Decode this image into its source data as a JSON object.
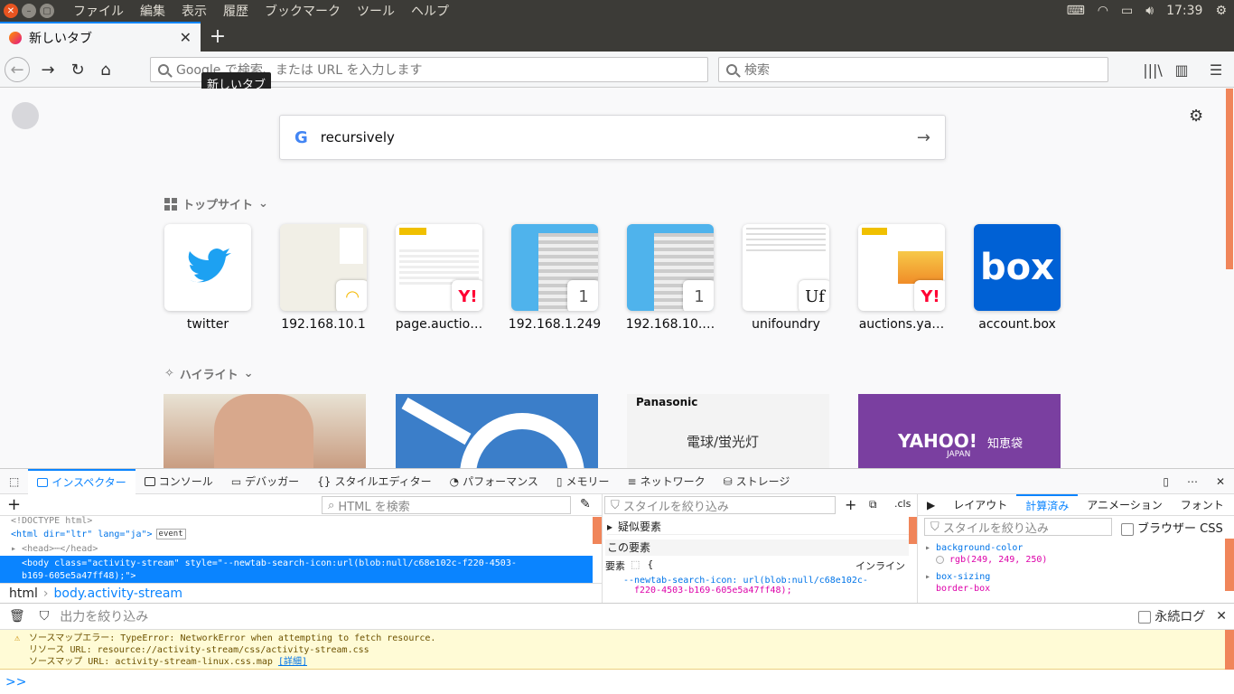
{
  "system": {
    "menu": [
      "ファイル",
      "編集",
      "表示",
      "履歴",
      "ブックマーク",
      "ツール",
      "ヘルプ"
    ],
    "time": "17:39"
  },
  "tab": {
    "title": "新しいタブ",
    "tooltip": "新しいタブ"
  },
  "nav": {
    "url_placeholder": "Google で検索、または URL を入力します",
    "search_placeholder": "検索"
  },
  "newtab": {
    "search_value": "recursively",
    "top_sites_header": "トップサイト",
    "highlights_header": "ハイライト",
    "sites": [
      {
        "label": "twitter"
      },
      {
        "label": "192.168.10.1"
      },
      {
        "label": "page.auctio…"
      },
      {
        "label": "192.168.1.249",
        "badge": "1"
      },
      {
        "label": "192.168.10.…",
        "badge": "1"
      },
      {
        "label": "unifoundry",
        "badge": "Uf"
      },
      {
        "label": "auctions.ya…"
      },
      {
        "label": "account.box",
        "logo": "box"
      }
    ],
    "highlights": {
      "panasonic": "Panasonic",
      "bulb": "電球/蛍光灯",
      "yahoo": "YAHOO!",
      "yahoo_sub": "JAPAN",
      "chiebukuro": "知恵袋"
    }
  },
  "devtools": {
    "tabs": [
      "インスペクター",
      "コンソール",
      "デバッガー",
      "スタイルエディター",
      "パフォーマンス",
      "メモリー",
      "ネットワーク",
      "ストレージ"
    ],
    "html_search_placeholder": "HTML を検索",
    "styles_filter_placeholder": "スタイルを絞り込み",
    "cls": ".cls",
    "markup": {
      "doctype": "<!DOCTYPE html>",
      "html": "<html dir=\"ltr\" lang=\"ja\">",
      "event": "event",
      "head": "<head>",
      "head_close": "</head>",
      "body1": "<body class=\"activity-stream\" style=\"--newtab-search-icon:url(blob:null/c68e102c-f220-4503-",
      "body2": "b169-605e5a47ff48);\">"
    },
    "breadcrumbs": [
      "html",
      "body.activity-stream"
    ],
    "rules": {
      "pseudo": "疑似要素",
      "this_element": "この要素",
      "element": "要素",
      "brace": "{",
      "inline": "インライン",
      "decl1": "--newtab-search-icon: url(blob:null/c68e102c-",
      "decl2": "f220-4503-b169-605e5a47ff48);"
    },
    "side_tabs": [
      "レイアウト",
      "計算済み",
      "アニメーション",
      "フォント"
    ],
    "computed_filter": "スタイルを絞り込み",
    "browser_styles": "ブラウザー CSS",
    "computed": [
      {
        "prop": "background-color",
        "value": "rgb(249, 249, 250)"
      },
      {
        "prop": "box-sizing",
        "value": "border-box"
      }
    ],
    "console_filter": "出力を絞り込み",
    "persist_logs": "永続ログ",
    "warning": {
      "line1": "ソースマップエラー: TypeError: NetworkError when attempting to fetch resource.",
      "line2": "リソース URL: resource://activity-stream/css/activity-stream.css",
      "line3": "ソースマップ URL: activity-stream-linux.css.map",
      "link": "[詳細]"
    },
    "prompt": ">>"
  },
  "colors": {
    "accent": "#0a84ff",
    "ubuntu_orange": "#e95420",
    "twitter": "#1da1f2",
    "box": "#0061d5"
  }
}
